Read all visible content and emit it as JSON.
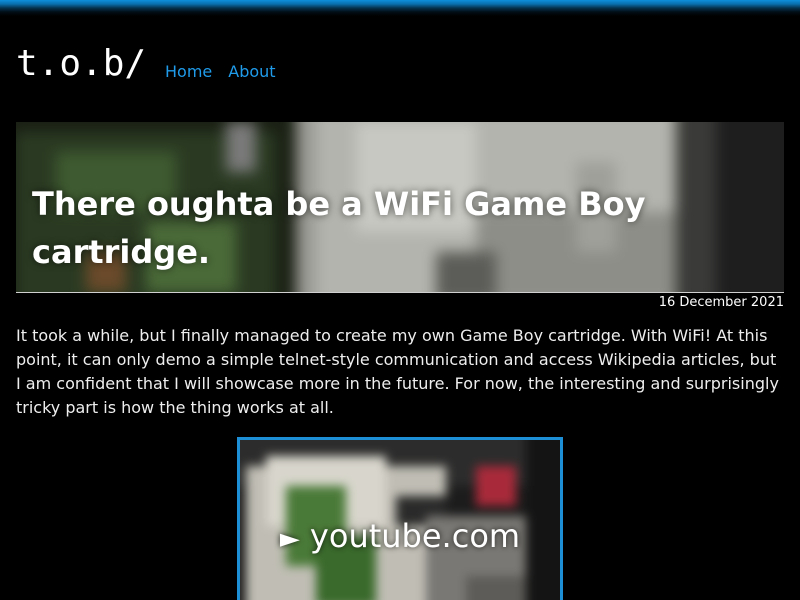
{
  "site": {
    "logo": "t.o.b/",
    "accent_color": "#1f9bea"
  },
  "nav": {
    "items": [
      {
        "label": "Home"
      },
      {
        "label": "About"
      }
    ]
  },
  "post": {
    "title": "There oughta be a WiFi Game Boy cartridge.",
    "date": "16 December 2021",
    "intro": "It took a while, but I finally managed to create my own Game Boy cartridge. With WiFi! At this point, it can only demo a simple telnet-style communication and access Wikipedia articles, but I am confident that I will showcase more in the future. For now, the interesting and surprisingly tricky part is how the thing works at all."
  },
  "video": {
    "play_icon": "play-icon",
    "label": "youtube.com",
    "border_color": "#1c8fd6"
  }
}
